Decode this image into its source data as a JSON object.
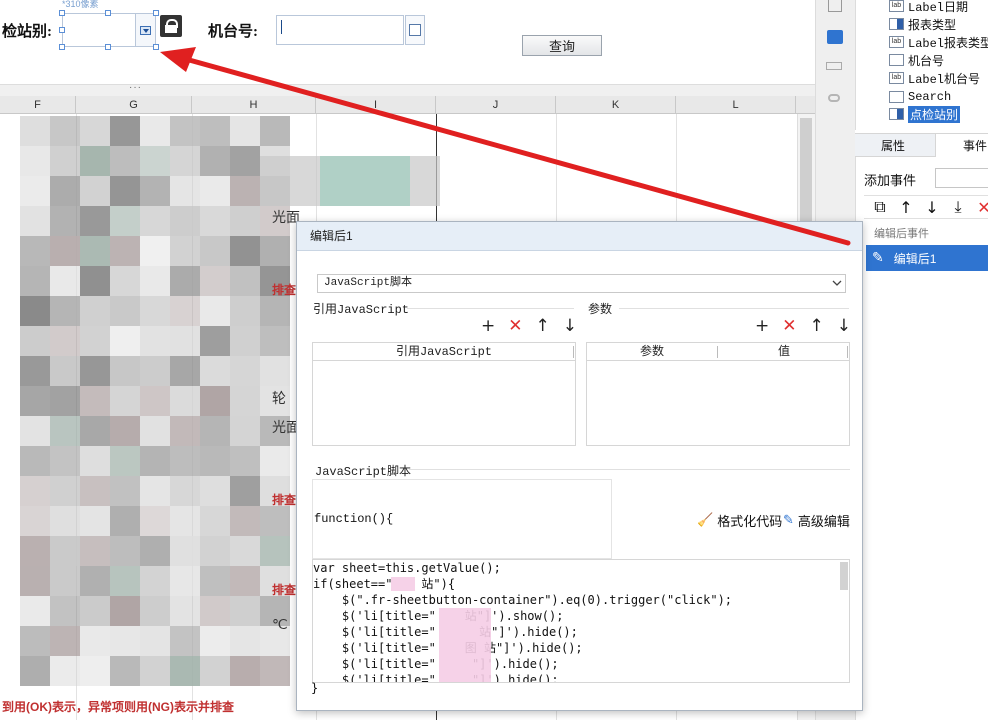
{
  "form": {
    "station_label": "检站别:",
    "station_caption": "*310像素",
    "machine_label": "机台号:",
    "query_button": "查询"
  },
  "grid": {
    "columns": [
      "F",
      "G",
      "H",
      "I",
      "J",
      "K",
      "L"
    ],
    "cell_texts": [
      "光面",
      "轮",
      "光面",
      "℃"
    ],
    "red_fragments": [
      "排查",
      "排查",
      "排查",
      "到用(OK)表示，异常项则用(NG)表示并排查"
    ]
  },
  "tree": {
    "items": [
      {
        "label": "Label日期",
        "icon": "label-icon",
        "badge": "lab"
      },
      {
        "label": "报表类型",
        "icon": "combobox-icon",
        "badge": ""
      },
      {
        "label": "Label报表类型",
        "icon": "label-icon",
        "badge": "lab"
      },
      {
        "label": "机台号",
        "icon": "textfield-icon",
        "badge": ""
      },
      {
        "label": "Label机台号",
        "icon": "label-icon",
        "badge": "lab"
      },
      {
        "label": "Search",
        "icon": "search-widget-icon",
        "badge": ""
      },
      {
        "label": "点检站别",
        "icon": "combobox-icon",
        "badge": "",
        "selected": true
      }
    ]
  },
  "props": {
    "tab_attr": "属性",
    "tab_event": "事件",
    "add_event_label": "添加事件",
    "event_group": "编辑后事件",
    "event_item": "编辑后1"
  },
  "dialog": {
    "title": "编辑后1",
    "type_value": "JavaScript脚本",
    "ref_js_label": "引用JavaScript",
    "params_label": "参数",
    "ref_js_col": "引用JavaScript",
    "param_col": "参数",
    "value_col": "值",
    "script_label": "JavaScript脚本",
    "func_header": "function(){",
    "format_code": "格式化代码",
    "advanced_edit": "高级编辑",
    "code_close": "}",
    "code_lines": [
      "var sheet=this.getValue();",
      "if(sheet==\"    站\"){",
      "    $(\".fr-sheetbutton-container\").eq(0).trigger(\"click\");",
      "    $('li[title=\"    站\"]').show();",
      "    $('li[title=\"      站\"]').hide();",
      "    $('li[title=\"    图 站\"]').hide();",
      "    $('li[title=\"     \"]').hide();",
      "    $('li[title=\"     \"]').hide();"
    ]
  },
  "colors": {
    "selection_blue": "#2f74d0",
    "annotation_red": "#e02020",
    "delete_red": "#e03030"
  }
}
